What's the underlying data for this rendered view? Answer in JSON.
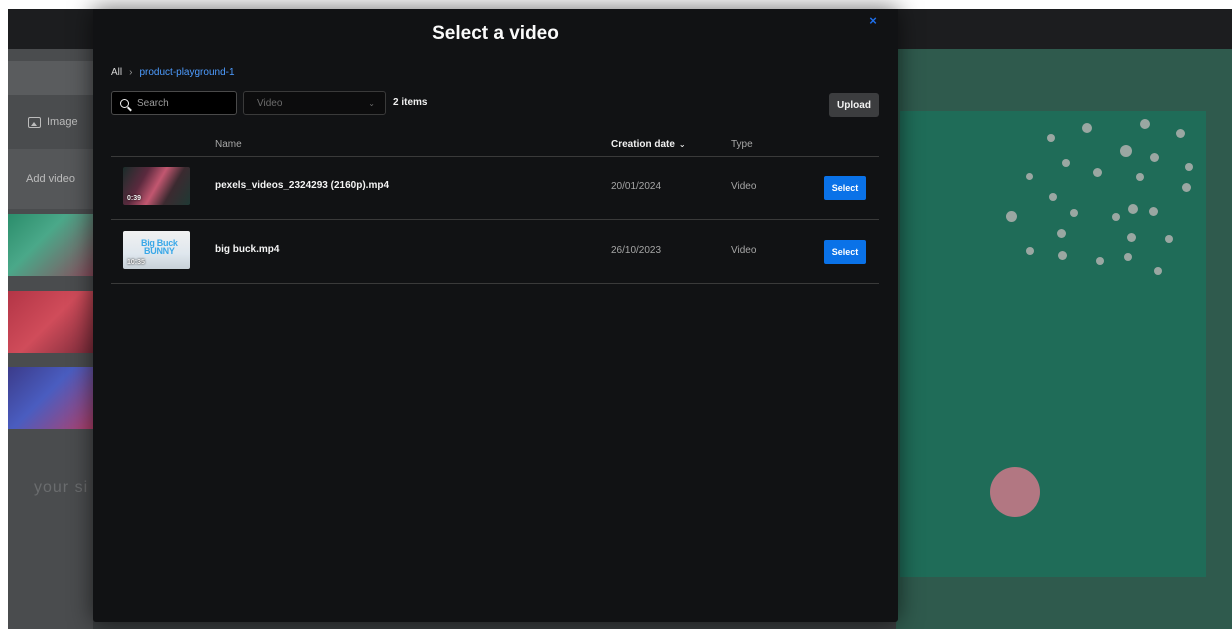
{
  "background": {
    "left_rail": {
      "image_label": "Image",
      "add_video_label": "Add video",
      "faded_text": "your si"
    }
  },
  "modal": {
    "title": "Select a video",
    "close_glyph": "×",
    "breadcrumb": {
      "root": "All",
      "separator": "›",
      "folder": "product-playground-1"
    },
    "search": {
      "placeholder": "Search",
      "value": ""
    },
    "type_filter": {
      "selected": "Video",
      "chevron": "⌄"
    },
    "items_count": "2 items",
    "upload_label": "Upload",
    "table": {
      "columns": {
        "name": "Name",
        "creation_date": "Creation date",
        "sort_chevron": "⌄",
        "type": "Type"
      },
      "rows": [
        {
          "name": "pexels_videos_2324293 (2160p).mp4",
          "duration": "0:39",
          "creation_date": "20/01/2024",
          "type": "Video",
          "select_label": "Select"
        },
        {
          "name": "big buck.mp4",
          "duration": "10:35",
          "thumb_logo_line1": "Big Buck",
          "thumb_logo_line2": "BUNNY",
          "creation_date": "26/10/2023",
          "type": "Video",
          "select_label": "Select"
        }
      ]
    }
  },
  "colors": {
    "accent": "#0a72e8",
    "link": "#4d9cff",
    "modal_bg": "#111214"
  }
}
